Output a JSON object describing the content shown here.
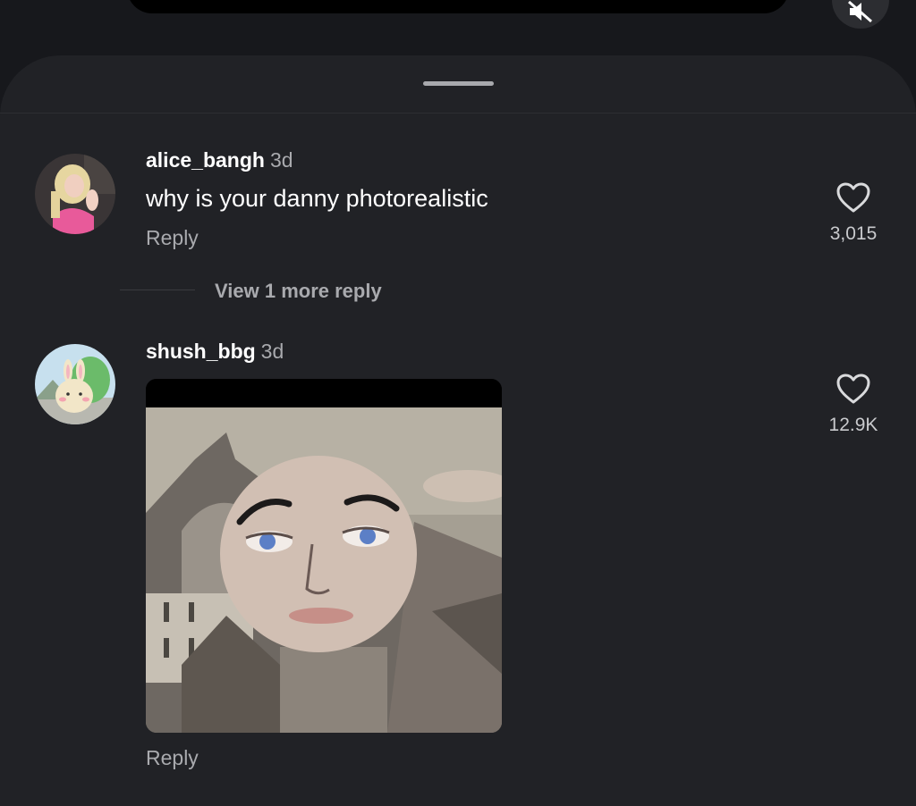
{
  "video": {
    "mute_icon": "muted-speaker-icon"
  },
  "comments": [
    {
      "username": "alice_bangh",
      "time": "3d",
      "text": "why is your danny photorealistic",
      "reply_label": "Reply",
      "likes": "3,015"
    },
    {
      "username": "shush_bbg",
      "time": "3d",
      "reply_label": "Reply",
      "likes": "12.9K"
    }
  ],
  "view_more_replies": "View 1 more reply",
  "colors": {
    "background": "#17181c",
    "sheet": "#212226",
    "secondary_text": "#a9aaae"
  }
}
